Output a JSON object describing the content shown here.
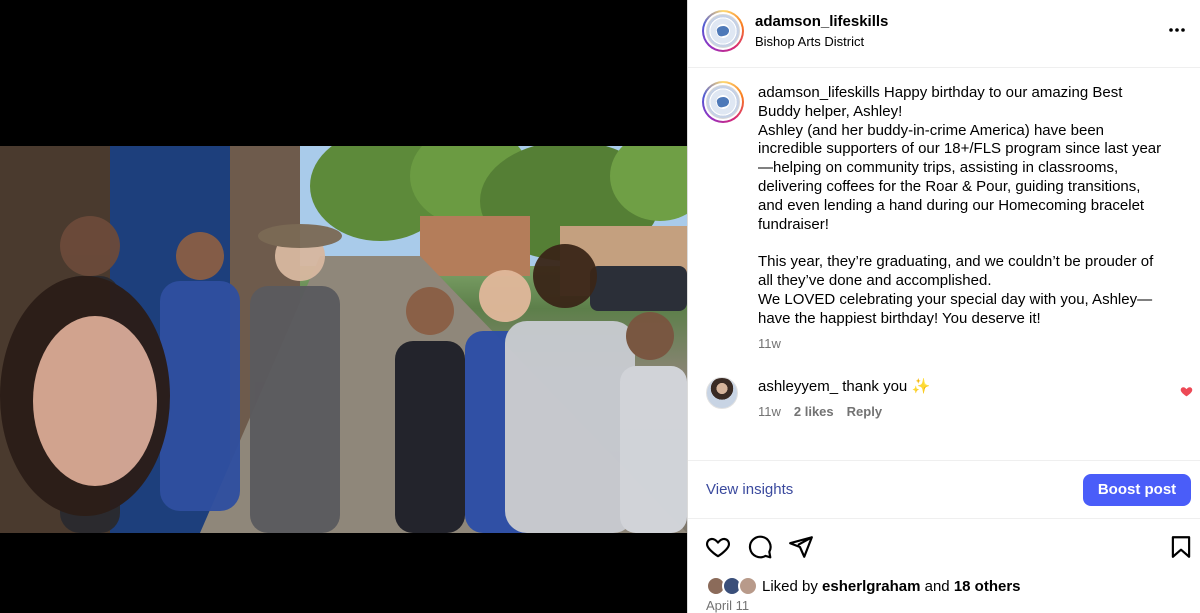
{
  "post": {
    "username": "adamson_lifeskills",
    "location": "Bishop Arts District",
    "more_icon": "more-horizontal-icon"
  },
  "caption": {
    "username": "adamson_lifeskills",
    "text": " Happy birthday to our amazing Best Buddy helper, Ashley!\nAshley (and her buddy-in-crime America) have been incredible supporters of our 18+/FLS program since last year—helping on community trips, assisting in classrooms, delivering coffees for the Roar & Pour, guiding transitions, and even lending a hand during our Homecoming bracelet fundraiser!\n\nThis year, they’re graduating, and we couldn’t be prouder of all they’ve done and accomplished.\nWe LOVED celebrating your special day with you, Ashley—have the happiest birthday! You deserve it!",
    "time": "11w"
  },
  "comment": {
    "username": "ashleyyem_",
    "text": " thank you ",
    "emoji": "✨",
    "time": "11w",
    "likes": "2 likes",
    "reply": "Reply",
    "liked_color": "#ed4956"
  },
  "insights": {
    "view_label": "View insights",
    "boost_label": "Boost post",
    "boost_color": "#4a5df9"
  },
  "likes": {
    "prefix": "Liked by ",
    "user": "esherlgraham",
    "middle": " and ",
    "others": "18 others"
  },
  "date": "April 11"
}
